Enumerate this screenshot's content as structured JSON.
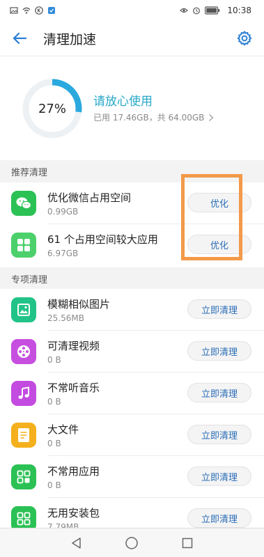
{
  "status_bar": {
    "time": "10:38"
  },
  "header": {
    "title": "清理加速"
  },
  "summary": {
    "percent_label": "27%",
    "used_fraction": 0.27,
    "status": "请放心使用",
    "detail": "已用 17.46GB，共 64.00GB"
  },
  "sections": {
    "recommended": "推荐清理",
    "special": "专项清理"
  },
  "recommended_items": [
    {
      "title": "优化微信占用空间",
      "sub": "0.99GB",
      "button": "优化",
      "icon": "wechat-icon"
    },
    {
      "title": "61 个占用空间较大应用",
      "sub": "6.97GB",
      "button": "优化",
      "icon": "apps-grid-icon"
    }
  ],
  "special_items": [
    {
      "title": "模糊相似图片",
      "sub": "25.56MB",
      "button": "立即清理",
      "icon": "image-icon"
    },
    {
      "title": "可清理视频",
      "sub": "0 B",
      "button": "立即清理",
      "icon": "video-reel-icon"
    },
    {
      "title": "不常听音乐",
      "sub": "0 B",
      "button": "立即清理",
      "icon": "music-note-icon"
    },
    {
      "title": "大文件",
      "sub": "0 B",
      "button": "立即清理",
      "icon": "document-icon"
    },
    {
      "title": "不常用应用",
      "sub": "0 B",
      "button": "立即清理",
      "icon": "apps-grid-icon"
    },
    {
      "title": "无用安装包",
      "sub": "7.79MB",
      "button": "立即清理",
      "icon": "package-grid-icon"
    }
  ],
  "colors": {
    "accent": "#26a8c9",
    "ring": "#2aa9de",
    "highlight": "#f2994a",
    "wechat": "#2cc155",
    "apps": "#4cd06b",
    "image": "#22c389",
    "video": "#c64fe0",
    "music": "#c34be0",
    "document": "#f5b11d"
  }
}
